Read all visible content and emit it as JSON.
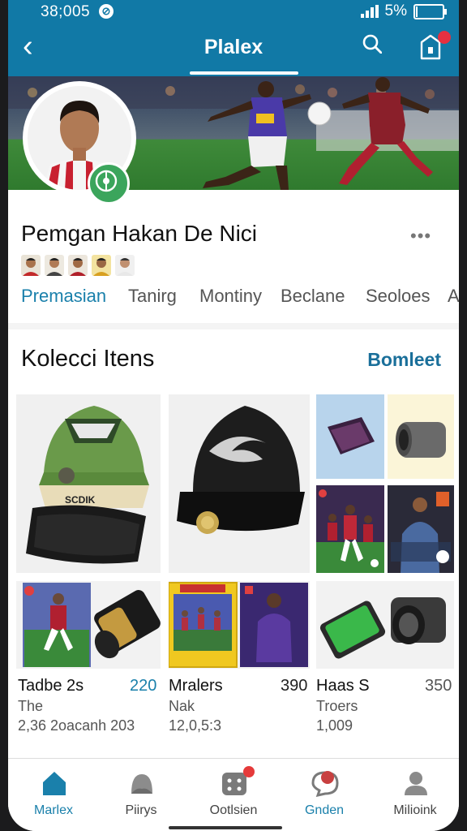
{
  "status_bar": {
    "time": "38;005",
    "battery": "5%"
  },
  "header": {
    "title": "Plalex"
  },
  "profile": {
    "name": "Pemgan Hakan De Nici",
    "more": "•••"
  },
  "tabs": [
    {
      "label": "Premasian"
    },
    {
      "label": "Tanirg"
    },
    {
      "label": "Montiny"
    },
    {
      "label": "Beclane"
    },
    {
      "label": "Seoloes"
    },
    {
      "label": "A"
    }
  ],
  "section": {
    "title": "Kolecci Itens",
    "link": "Bomleet"
  },
  "products": [
    {
      "name": "Tadbe 2s",
      "price": "220",
      "sub": "The",
      "num": "2,36 2oacanh 203"
    },
    {
      "name": "Mralers",
      "price": "390",
      "sub": "Nak",
      "num": "12,0,5:3"
    },
    {
      "name": "Haas S",
      "price": "350",
      "sub": "Troers",
      "num": "1,009"
    }
  ],
  "cap_text": "SCDIK",
  "nav": [
    {
      "label": "Marlex",
      "icon": "home-icon"
    },
    {
      "label": "Piirys",
      "icon": "people-icon"
    },
    {
      "label": "Ootlsien",
      "icon": "grid-icon"
    },
    {
      "label": "Gnden",
      "icon": "chat-icon"
    },
    {
      "label": "Milioink",
      "icon": "profile-icon"
    }
  ],
  "colors": {
    "header": "#1179a6",
    "accent": "#1a80ab",
    "price": "#1a80ab",
    "badge": "#e53040"
  }
}
